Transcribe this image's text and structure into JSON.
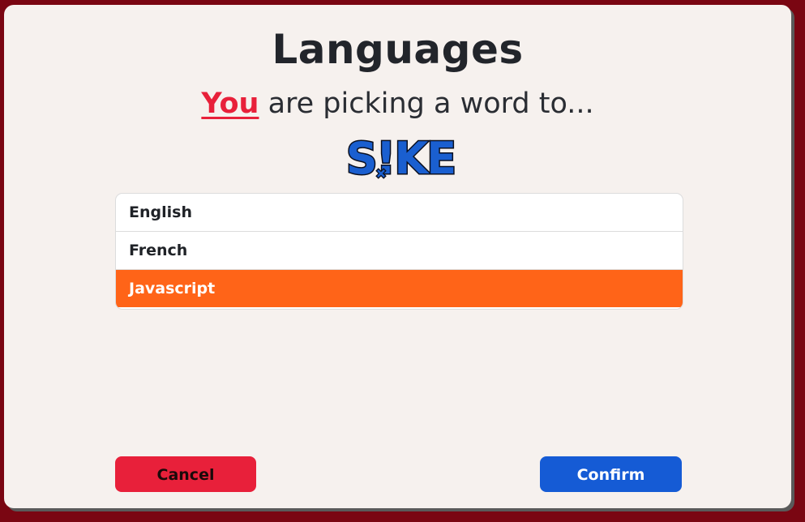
{
  "dialog": {
    "title": "Languages",
    "subtitle_highlight": "You",
    "subtitle_rest": " are picking a word to...",
    "logo_text": "S!KE"
  },
  "languages": [
    {
      "label": "English",
      "selected": false
    },
    {
      "label": "French",
      "selected": false
    },
    {
      "label": "Javascript",
      "selected": true
    }
  ],
  "buttons": {
    "cancel_label": "Cancel",
    "confirm_label": "Confirm"
  },
  "colors": {
    "background": "#7a0612",
    "panel": "#f6f1ee",
    "accent_red": "#e8203a",
    "selected_orange": "#ff6418",
    "confirm_blue": "#155bd5",
    "logo_blue": "#1a5fd0"
  }
}
